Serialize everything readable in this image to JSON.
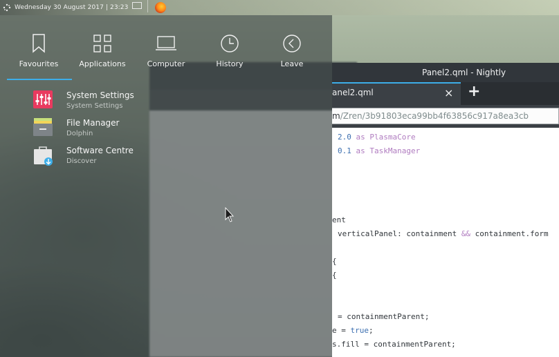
{
  "top_panel": {
    "clock": "Wednesday 30 August 2017 | 23:23"
  },
  "launcher": {
    "tabs": [
      {
        "label": "Favourites",
        "icon": "bookmark-icon"
      },
      {
        "label": "Applications",
        "icon": "grid-icon"
      },
      {
        "label": "Computer",
        "icon": "laptop-icon"
      },
      {
        "label": "History",
        "icon": "clock-icon"
      },
      {
        "label": "Leave",
        "icon": "back-arrow-icon"
      }
    ],
    "active_tab": "Favourites",
    "favourites": [
      {
        "name": "System Settings",
        "subtitle": "System Settings",
        "icon": "settings-sliders-icon"
      },
      {
        "name": "File Manager",
        "subtitle": "Dolphin",
        "icon": "folder-icon"
      },
      {
        "name": "Software Centre",
        "subtitle": "Discover",
        "icon": "shopping-bag-icon"
      }
    ]
  },
  "nightly_window": {
    "title": "Panel2.qml - Nightly",
    "tab_label": "anel2.qml",
    "tab_close": "×",
    "new_tab": "+",
    "url_prefix": "m",
    "url_rest": "/Zren/3b91803eca99bb4f63856c917a8ea3cb",
    "code_lines": [
      {
        "parts": [
          {
            "t": "2.0",
            "c": "num"
          },
          {
            "t": " as ",
            "c": "kw"
          },
          {
            "t": "PlasmaCore",
            "c": "kw"
          }
        ]
      },
      {
        "parts": [
          {
            "t": "0.1",
            "c": "num"
          },
          {
            "t": " as ",
            "c": "kw"
          },
          {
            "t": "TaskManager",
            "c": "kw"
          }
        ]
      },
      {
        "parts": [
          {
            "t": "ent",
            "c": ""
          }
        ]
      },
      {
        "parts": [
          {
            "t": "verticalPanel: containment ",
            "c": ""
          },
          {
            "t": "&&",
            "c": "kw"
          },
          {
            "t": " containment.form",
            "c": ""
          }
        ]
      },
      {
        "parts": [
          {
            "t": "{",
            "c": ""
          }
        ]
      },
      {
        "parts": [
          {
            "t": "{",
            "c": ""
          }
        ]
      },
      {
        "parts": [
          {
            "t": "= containmentParent;",
            "c": ""
          }
        ]
      },
      {
        "parts": [
          {
            "t": "e = ",
            "c": ""
          },
          {
            "t": "true",
            "c": "num"
          },
          {
            "t": ";",
            "c": ""
          }
        ]
      },
      {
        "parts": [
          {
            "t": "s.fill = containmentParent;",
            "c": ""
          }
        ]
      }
    ]
  },
  "colors": {
    "accent": "#3daee9",
    "titlebar": "#31363b",
    "settings_icon": "#e93a5f"
  }
}
